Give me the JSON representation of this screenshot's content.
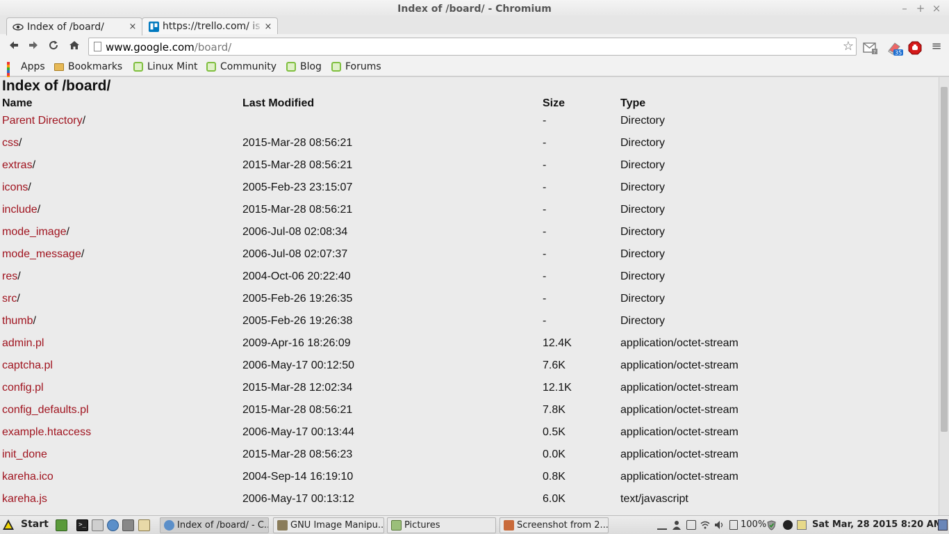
{
  "window": {
    "title": "Index of /board/ - Chromium",
    "controls": {
      "minimize": "–",
      "maximize": "+",
      "close": "×"
    }
  },
  "tabs": [
    {
      "title": "Index of /board/",
      "favicon": "page-icon",
      "active": true,
      "close": "×"
    },
    {
      "title": "https://trello.com/ is",
      "favicon": "trello-icon",
      "active": false,
      "close": "×"
    }
  ],
  "toolbar": {
    "back": "🡐",
    "forward": "🡒",
    "reload": "↻",
    "home": "⌂",
    "url_host": "www.google.com",
    "url_path": "/board/",
    "star": "☆",
    "menu": "≡",
    "extension_badge": "35"
  },
  "bookmarks": [
    {
      "label": "Apps",
      "icon": "apps-grid-icon"
    },
    {
      "label": "Bookmarks",
      "icon": "folder-icon"
    },
    {
      "label": "Linux Mint",
      "icon": "mint-icon"
    },
    {
      "label": "Community",
      "icon": "mint-icon"
    },
    {
      "label": "Blog",
      "icon": "mint-icon"
    },
    {
      "label": "Forums",
      "icon": "mint-icon"
    }
  ],
  "page": {
    "heading": "Index of /board/",
    "columns": {
      "name": "Name",
      "modified": "Last Modified",
      "size": "Size",
      "type": "Type"
    },
    "rows": [
      {
        "name": "Parent Directory",
        "suffix": "/",
        "modified": "",
        "size": "-",
        "type": "Directory"
      },
      {
        "name": "css",
        "suffix": "/",
        "modified": "2015-Mar-28 08:56:21",
        "size": "-",
        "type": "Directory"
      },
      {
        "name": "extras",
        "suffix": "/",
        "modified": "2015-Mar-28 08:56:21",
        "size": "-",
        "type": "Directory"
      },
      {
        "name": "icons",
        "suffix": "/",
        "modified": "2005-Feb-23 23:15:07",
        "size": "-",
        "type": "Directory"
      },
      {
        "name": "include",
        "suffix": "/",
        "modified": "2015-Mar-28 08:56:21",
        "size": "-",
        "type": "Directory"
      },
      {
        "name": "mode_image",
        "suffix": "/",
        "modified": "2006-Jul-08 02:08:34",
        "size": "-",
        "type": "Directory"
      },
      {
        "name": "mode_message",
        "suffix": "/",
        "modified": "2006-Jul-08 02:07:37",
        "size": "-",
        "type": "Directory"
      },
      {
        "name": "res",
        "suffix": "/",
        "modified": "2004-Oct-06 20:22:40",
        "size": "-",
        "type": "Directory"
      },
      {
        "name": "src",
        "suffix": "/",
        "modified": "2005-Feb-26 19:26:35",
        "size": "-",
        "type": "Directory"
      },
      {
        "name": "thumb",
        "suffix": "/",
        "modified": "2005-Feb-26 19:26:38",
        "size": "-",
        "type": "Directory"
      },
      {
        "name": "admin.pl",
        "suffix": "",
        "modified": "2009-Apr-16 18:26:09",
        "size": "12.4K",
        "type": "application/octet-stream"
      },
      {
        "name": "captcha.pl",
        "suffix": "",
        "modified": "2006-May-17 00:12:50",
        "size": "7.6K",
        "type": "application/octet-stream"
      },
      {
        "name": "config.pl",
        "suffix": "",
        "modified": "2015-Mar-28 12:02:34",
        "size": "12.1K",
        "type": "application/octet-stream"
      },
      {
        "name": "config_defaults.pl",
        "suffix": "",
        "modified": "2015-Mar-28 08:56:21",
        "size": "7.8K",
        "type": "application/octet-stream"
      },
      {
        "name": "example.htaccess",
        "suffix": "",
        "modified": "2006-May-17 00:13:44",
        "size": "0.5K",
        "type": "application/octet-stream"
      },
      {
        "name": "init_done",
        "suffix": "",
        "modified": "2015-Mar-28 08:56:23",
        "size": "0.0K",
        "type": "application/octet-stream"
      },
      {
        "name": "kareha.ico",
        "suffix": "",
        "modified": "2004-Sep-14 16:19:10",
        "size": "0.8K",
        "type": "application/octet-stream"
      },
      {
        "name": "kareha.js",
        "suffix": "",
        "modified": "2006-May-17 00:13:12",
        "size": "6.0K",
        "type": "text/javascript"
      }
    ]
  },
  "taskbar": {
    "start_label": "Start",
    "tasks": [
      {
        "label": "Index of /board/ - C...",
        "icon": "chromium-icon",
        "active": true
      },
      {
        "label": "GNU Image Manipu...",
        "icon": "gimp-icon",
        "active": false
      },
      {
        "label": "Pictures",
        "icon": "folder-icon",
        "active": false
      },
      {
        "label": "Screenshot from 2...",
        "icon": "image-viewer-icon",
        "active": false
      }
    ],
    "battery": "100%",
    "clock": "Sat Mar, 28 2015  8:20 AM"
  },
  "colors": {
    "link": "#a0141f",
    "page_bg": "#ebebeb",
    "chrome_bg": "#f2f2f2",
    "mint_green": "#7fbf3f"
  }
}
